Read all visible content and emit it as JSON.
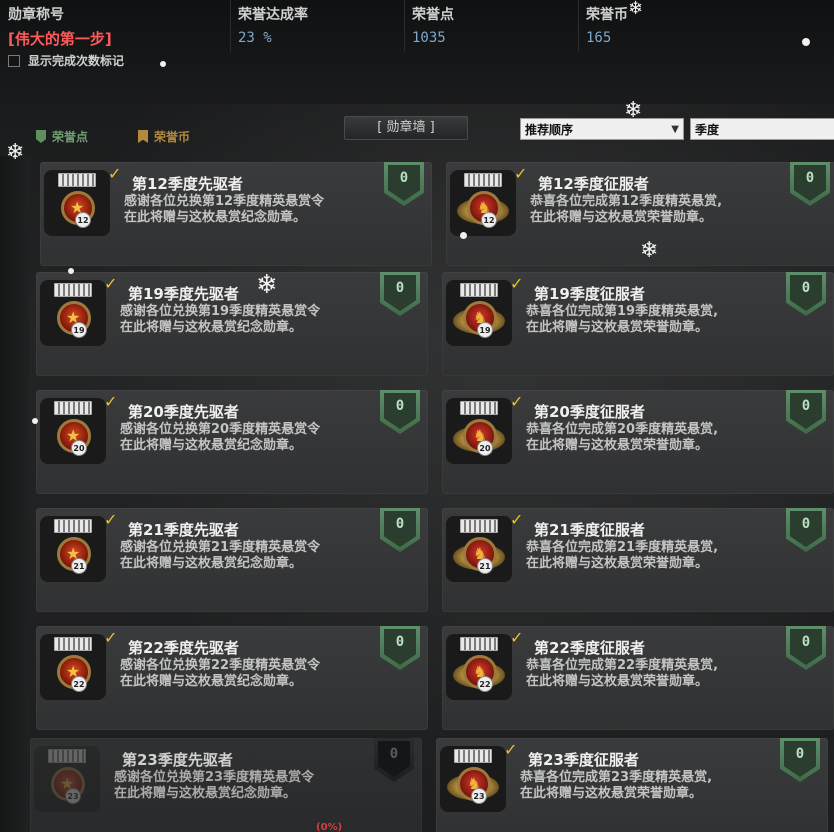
{
  "header": {
    "badge_title_label": "勋章称号",
    "badge_title_value": "[伟大的第一步]",
    "honor_rate_label": "荣誉达成率",
    "honor_rate_value": "23 %",
    "honor_points_label": "荣誉点",
    "honor_points_value": "1035",
    "honor_coins_label": "荣誉币",
    "honor_coins_value": "165",
    "show_count_label": "显示完成次数标记"
  },
  "filters": {
    "legend_points": "荣誉点",
    "legend_coins": "荣誉币",
    "wall_tab": "[ 勋章墙 ]",
    "sort_value": "推荐顺序",
    "category_value": "季度"
  },
  "cards": [
    {
      "title": "第12季度先驱者",
      "desc1": "感谢各位兑换第12季度精英悬赏令",
      "desc2": "在此将赠与这枚悬赏纪念勋章。",
      "points": "0",
      "medal_num": "12"
    },
    {
      "title": "第12季度征服者",
      "desc1": "恭喜各位完成第12季度精英悬赏,",
      "desc2": "在此将赠与这枚悬赏荣誉勋章。",
      "points": "0",
      "medal_num": "12"
    },
    {
      "title": "第19季度先驱者",
      "desc1": "感谢各位兑换第19季度精英悬赏令",
      "desc2": "在此将赠与这枚悬赏纪念勋章。",
      "points": "0",
      "medal_num": "19"
    },
    {
      "title": "第19季度征服者",
      "desc1": "恭喜各位完成第19季度精英悬赏,",
      "desc2": "在此将赠与这枚悬赏荣誉勋章。",
      "points": "0",
      "medal_num": "19"
    },
    {
      "title": "第20季度先驱者",
      "desc1": "感谢各位兑换第20季度精英悬赏令",
      "desc2": "在此将赠与这枚悬赏纪念勋章。",
      "points": "0",
      "medal_num": "20"
    },
    {
      "title": "第20季度征服者",
      "desc1": "恭喜各位完成第20季度精英悬赏,",
      "desc2": "在此将赠与这枚悬赏荣誉勋章。",
      "points": "0",
      "medal_num": "20"
    },
    {
      "title": "第21季度先驱者",
      "desc1": "感谢各位兑换第21季度精英悬赏令",
      "desc2": "在此将赠与这枚悬赏纪念勋章。",
      "points": "0",
      "medal_num": "21"
    },
    {
      "title": "第21季度征服者",
      "desc1": "恭喜各位完成第21季度精英悬赏,",
      "desc2": "在此将赠与这枚悬赏荣誉勋章。",
      "points": "0",
      "medal_num": "21"
    },
    {
      "title": "第22季度先驱者",
      "desc1": "感谢各位兑换第22季度精英悬赏令",
      "desc2": "在此将赠与这枚悬赏纪念勋章。",
      "points": "0",
      "medal_num": "22"
    },
    {
      "title": "第22季度征服者",
      "desc1": "恭喜各位完成第22季度精英悬赏,",
      "desc2": "在此将赠与这枚悬赏荣誉勋章。",
      "points": "0",
      "medal_num": "22"
    },
    {
      "title": "第23季度先驱者",
      "desc1": "感谢各位兑换第23季度精英悬赏令",
      "desc2": "在此将赠与这枚悬赏纪念勋章。",
      "points": "0",
      "medal_num": "23"
    },
    {
      "title": "第23季度征服者",
      "desc1": "恭喜各位完成第23季度精英悬赏,",
      "desc2": "在此将赠与这枚悬赏荣誉勋章。",
      "points": "0",
      "medal_num": "23"
    }
  ],
  "footer_percent": "(0%)",
  "icons": {
    "check": "checkmark-icon",
    "points_badge": "shield-icon",
    "snow": "snowflake-icon"
  },
  "colors": {
    "title_red": "#ff5a5a",
    "stat_blue": "#7fa7c9",
    "badge_green": "#5f8f6a",
    "check_gold": "#f0c020"
  }
}
